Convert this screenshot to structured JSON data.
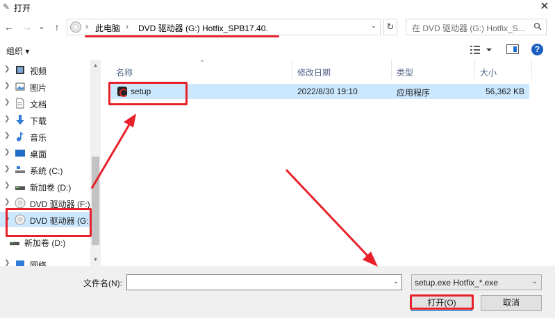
{
  "window": {
    "title": "打开",
    "close": "✕"
  },
  "nav": {
    "back": "←",
    "forward": "→",
    "history": "⌄",
    "up": "↑"
  },
  "address": {
    "sep": "›",
    "crumbs": [
      "此电脑",
      "DVD 驱动器 (G:) Hotfix_SPB17.40."
    ],
    "dropdown": "⌄",
    "refresh": "↻"
  },
  "search": {
    "placeholder": "在 DVD 驱动器 (G:) Hotfix_S..."
  },
  "toolbar": {
    "organize": "组织 ▾",
    "help": "?"
  },
  "sidebar": {
    "items": [
      {
        "label": "视频",
        "icon": "video-icon"
      },
      {
        "label": "图片",
        "icon": "picture-icon"
      },
      {
        "label": "文档",
        "icon": "document-icon"
      },
      {
        "label": "下载",
        "icon": "download-icon"
      },
      {
        "label": "音乐",
        "icon": "music-icon"
      },
      {
        "label": "桌面",
        "icon": "desktop-icon"
      },
      {
        "label": "系统 (C:)",
        "icon": "drive-icon"
      },
      {
        "label": "新加卷 (D:)",
        "icon": "drive-icon"
      },
      {
        "label": "DVD 驱动器 (F:)",
        "icon": "dvd-icon"
      },
      {
        "label": "DVD 驱动器 (G:",
        "icon": "dvd-icon"
      },
      {
        "label": "新加卷 (D:)",
        "icon": "drive-icon"
      },
      {
        "label": "网络",
        "icon": "network-icon"
      }
    ]
  },
  "columns": {
    "name": "名称",
    "date": "修改日期",
    "type": "类型",
    "size": "大小"
  },
  "files": [
    {
      "name": "setup",
      "date": "2022/8/30 19:10",
      "type": "应用程序",
      "size": "56,362 KB"
    }
  ],
  "footer": {
    "filename_label": "文件名(N):",
    "filename_value": "",
    "filter": "setup.exe Hotfix_*.exe",
    "open": "打开(O)",
    "cancel": "取消"
  },
  "colors": {
    "annotation": "#e8202a",
    "selection": "#cce8ff",
    "accent": "#0078d7"
  }
}
